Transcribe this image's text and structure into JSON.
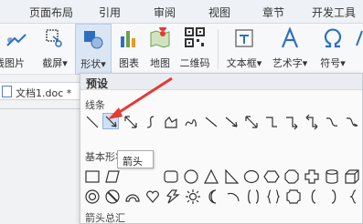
{
  "tabs": {
    "page_layout": "页面布局",
    "references": "引用",
    "review": "审阅",
    "view": "视图",
    "sections": "章节",
    "developer": "开发工具"
  },
  "ribbon": {
    "online_picture": "线图片",
    "screenshot": "截屏",
    "shapes": "形状",
    "chart": "图表",
    "map": "地图",
    "qrcode": "二维码",
    "textbox": "文本框",
    "wordart": "艺术字",
    "symbol": "符号",
    "dropdown_glyph": "▾",
    "accent_color": "#2f6ebf"
  },
  "document_tab": {
    "name": "文档1.doc *"
  },
  "shape_panel": {
    "header": "预设",
    "sections": {
      "lines": "线条",
      "basic_shapes": "基本形状",
      "arrows": "箭头总汇"
    },
    "tooltip": "箭头",
    "selected_shape": "arrow-line",
    "line_shapes": [
      "line",
      "arrow-line",
      "double-arrow-line",
      "curve",
      "freeform",
      "scribble",
      "elbow-connector",
      "elbow-arrow-connector",
      "elbow-double-arrow-connector",
      "curved-connector",
      "curved-arrow-connector",
      "curved-double-arrow-connector"
    ],
    "annotation_color": "#e53935"
  }
}
